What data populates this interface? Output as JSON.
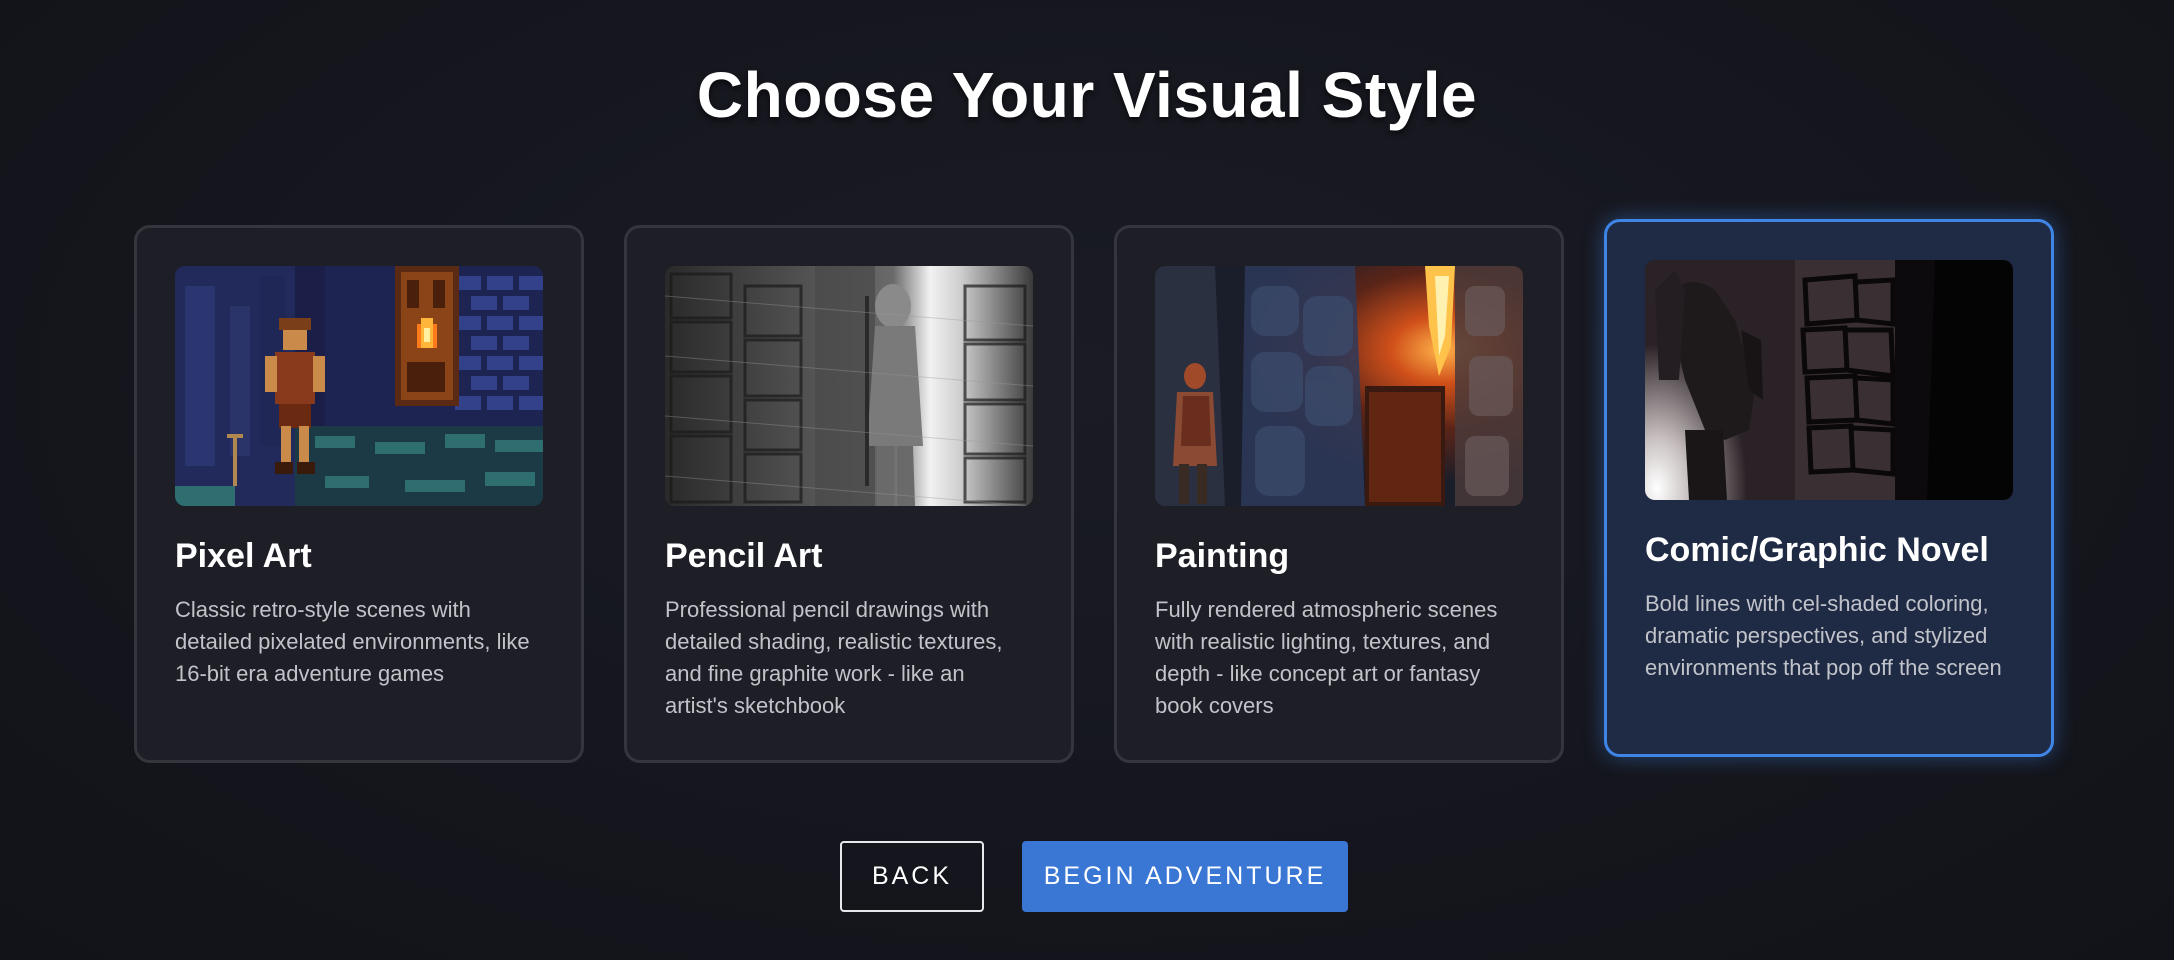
{
  "header": {
    "title": "Choose Your Visual Style"
  },
  "styles": [
    {
      "title": "Pixel Art",
      "description": "Classic retro-style scenes with detailed pixelated environments, like 16-bit era adventure games",
      "selected": false
    },
    {
      "title": "Pencil Art",
      "description": "Professional pencil drawings with detailed shading, realistic textures, and fine graphite work - like an artist's sketchbook",
      "selected": false
    },
    {
      "title": "Painting",
      "description": "Fully rendered atmospheric scenes with realistic lighting, textures, and depth - like concept art or fantasy book covers",
      "selected": false
    },
    {
      "title": "Comic/Graphic Novel",
      "description": "Bold lines with cel-shaded coloring, dramatic perspectives, and stylized environments that pop off the screen",
      "selected": true
    }
  ],
  "actions": {
    "back_label": "BACK",
    "begin_label": "BEGIN ADVENTURE"
  },
  "colors": {
    "background": "#15161d",
    "card_background": "#1e1f26",
    "card_border": "#35363d",
    "selected_background": "#1f2a44",
    "selected_border": "#3f85e6",
    "primary_button": "#3a76d4",
    "description_text": "#c1c3ca"
  }
}
